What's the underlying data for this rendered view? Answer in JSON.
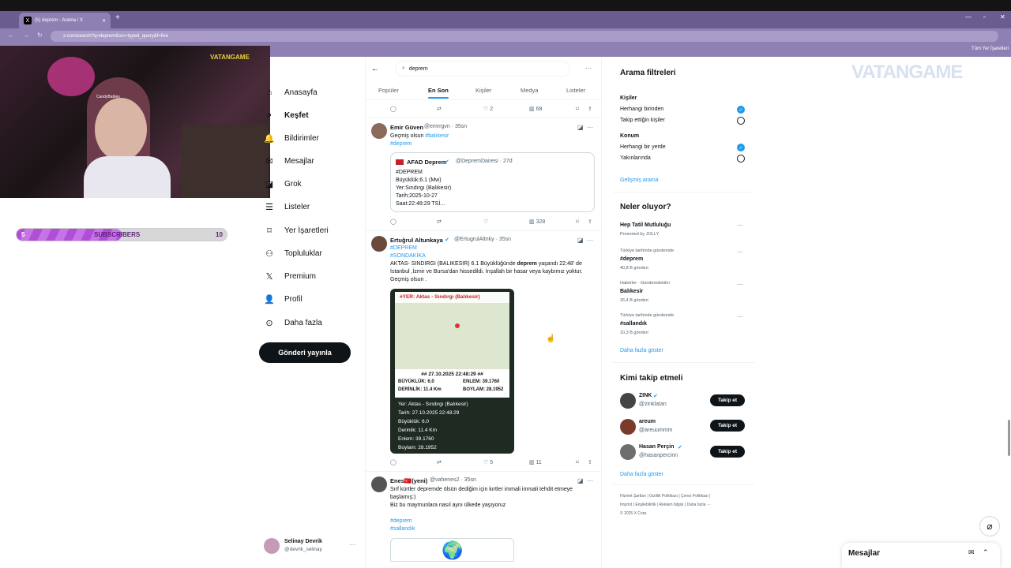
{
  "browser": {
    "tab_title": "(5) deprem - Arama / X",
    "url": "x.com/search?q=deprem&src=typed_query&f=live",
    "bookmarks_label": "Tüm Yer İşaretleri"
  },
  "overlay": {
    "webcam_name": "CandyBabies",
    "brand": "VATANGAME",
    "subs_label": "SUBSCRIBERS",
    "subs_current": "5",
    "subs_goal": "10",
    "subs_progress": 0.5
  },
  "sidebar": {
    "items": [
      {
        "label": "Anasayfa",
        "icon": "home-icon"
      },
      {
        "label": "Keşfet",
        "icon": "search-icon"
      },
      {
        "label": "Bildirimler",
        "icon": "bell-icon"
      },
      {
        "label": "Mesajlar",
        "icon": "mail-icon"
      },
      {
        "label": "Grok",
        "icon": "grok-icon"
      },
      {
        "label": "Listeler",
        "icon": "list-icon"
      },
      {
        "label": "Yer İşaretleri",
        "icon": "bookmark-icon"
      },
      {
        "label": "Topluluklar",
        "icon": "communities-icon"
      },
      {
        "label": "Premium",
        "icon": "x-icon"
      },
      {
        "label": "Profil",
        "icon": "person-icon"
      },
      {
        "label": "Daha fazla",
        "icon": "more-icon"
      }
    ],
    "post_button": "Gönderi yayınla",
    "user_name": "Selinay Devrik",
    "user_handle": "@devrik_selinay"
  },
  "search": {
    "query": "deprem",
    "tabs": [
      "Popüler",
      "En Son",
      "Kişiler",
      "Medya",
      "Listeler"
    ],
    "active_tab": "En Son"
  },
  "tweets": {
    "prev_likes": "2",
    "prev_views": "68",
    "t1": {
      "name": "Emir Güven",
      "handle": "@emrrgvn · 35sn",
      "text": "Geçmiş olsun",
      "mention": "#balıkesir",
      "hashtag": "#deprem",
      "quote_name": "AFAD Deprem",
      "quote_handle": "@DepremDairesi · 27d",
      "quote_lines": [
        "#DEPREM",
        "Büyüklük:6.1 (Mw)",
        "Yer:Sındırgı (Balıkesir)",
        "Tarih:2025-10-27",
        "Saat:22:48:29 TSİ..."
      ],
      "views": "328"
    },
    "t2": {
      "name": "Ertuğrul Altunkaya",
      "handle": "@ErtugrulAltnky · 35sn",
      "tags": [
        "#DEPREM",
        "#SONDAKİKA"
      ],
      "text_pre": "AKTAS- SINDIRGI (BALIKESIR) 6.1 Büyüklüğünde ",
      "text_bold": "deprem",
      "text_post": " yaşandı 22:48' de İstanbul ,İzmir ve Bursa'dan hissedildi. İnşallah bir hasar veya kaybımız yoktur. Geçmiş olsun .",
      "card_header": "#YER: Aktas - Sındırgı (Balıkesir)",
      "card_datetime": "## 27.10.2025 22:48:29 ##",
      "card_grid": [
        "BÜYÜKLÜK: 6.0",
        "ENLEM: 39.1760",
        "DERİNLİK: 11.4 Km",
        "BOYLAM: 28.1952"
      ],
      "card_list": [
        "Yer: Aktas - Sındırgı (Balıkesir)",
        "Tarih: 27.10.2025 22:48:29",
        "Büyüklük: 6.0",
        "Derinlik: 11.4 Km",
        "Enlem: 39.1760",
        "Boylam: 28.1952"
      ],
      "likes": "5",
      "views": "11"
    },
    "t3": {
      "name": "Enes🇹🇷(yeni)",
      "handle": "@vahenes2 · 35sn",
      "text1": "Sırf kürtler depremde ölsün dediğim için kırtler immali immali tehdit etmeye başlamış:)",
      "text2": "Biz bu maymunlara nasıl aynı ülkede yaşıyoruz",
      "tags": [
        "#deprem",
        "#sallandık"
      ]
    }
  },
  "right": {
    "filters_title": "Arama filtreleri",
    "people_title": "Kişiler",
    "people_opt1": "Herhangi birinden",
    "people_opt2": "Takip ettiğin kişiler",
    "location_title": "Konum",
    "location_opt1": "Herhangi bir yerde",
    "location_opt2": "Yakınlarında",
    "advanced": "Gelişmiş arama",
    "trends_title": "Neler oluyor?",
    "trends": [
      {
        "context": "",
        "name": "Hep Tatil Mutluluğu",
        "count": "Promoted by JOLLY"
      },
      {
        "context": "Türkiye tarihinde gündemde",
        "name": "#deprem",
        "count": "40,8 B gönderi"
      },
      {
        "context": "Haberler · Gündemdekiler",
        "name": "Balıkesir",
        "count": "26,4 B gönderi"
      },
      {
        "context": "Türkiye tarihinde gündemde",
        "name": "#sallandık",
        "count": "10,3 B gönderi"
      }
    ],
    "show_more": "Daha fazla göster",
    "who_title": "Kimi takip etmeli",
    "who": [
      {
        "name": "ZINK",
        "handle": "@zinklatan"
      },
      {
        "name": "areum",
        "handle": "@areuummm"
      },
      {
        "name": "Hasan Perçin",
        "handle": "@hasanpercinn"
      }
    ],
    "follow_label": "Takip et",
    "footer1": "Hizmet Şartları  |  Gizlilik Politikası  |  Çerez Politikası  |",
    "footer2": "İmprint  |  Erişilebilirlik  |  Reklam bilgisi  |  Daha fazla ···",
    "footer3": "© 2025 X Corp.",
    "messages": "Mesajlar"
  }
}
